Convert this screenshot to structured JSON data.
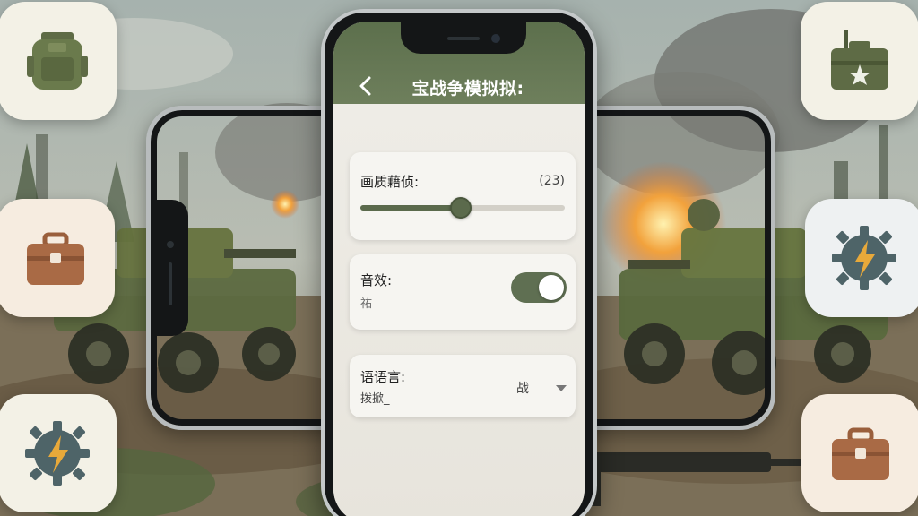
{
  "screen": {
    "title": "宝战争模拟拟:",
    "back_icon": "chevron-left-icon"
  },
  "settings": {
    "quality": {
      "label": "画质藉侦:",
      "value_text": "(23)",
      "slider_fraction": 0.49
    },
    "sound": {
      "label": "音效:",
      "sub": "祐",
      "enabled": true
    },
    "language": {
      "label": "语语言:",
      "sub": "拨掀_",
      "selected": "战"
    }
  },
  "tiles": [
    {
      "icon": "backpack-icon"
    },
    {
      "icon": "toolbox-icon"
    },
    {
      "icon": "gear-lightning-icon"
    },
    {
      "icon": "radio-crate-icon"
    },
    {
      "icon": "gear-lightning-icon"
    },
    {
      "icon": "toolbox-icon"
    }
  ],
  "colors": {
    "accent": "#5b6a4c",
    "header": "#5c6f4c",
    "card": "#f6f5f1"
  }
}
